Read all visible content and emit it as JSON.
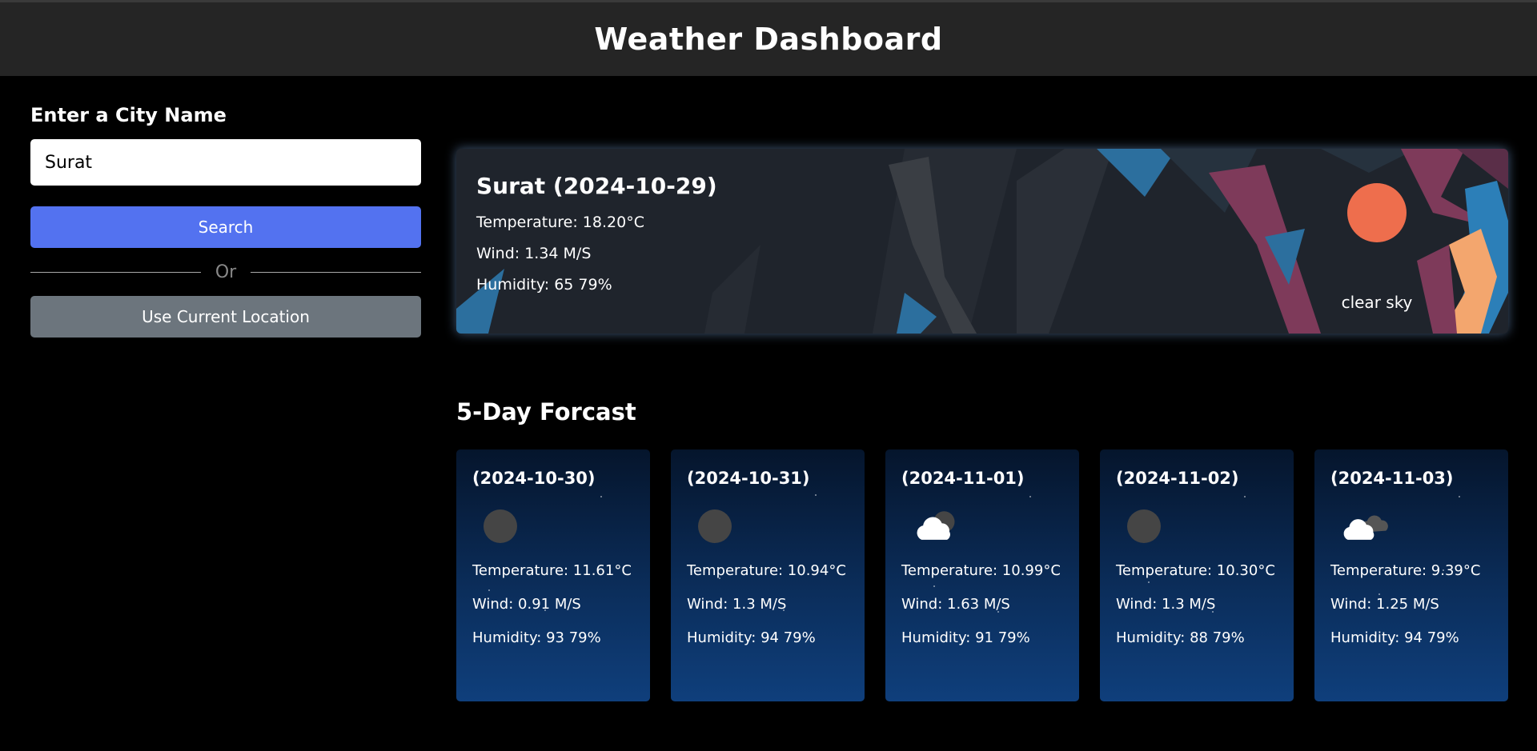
{
  "header": {
    "title": "Weather Dashboard"
  },
  "search": {
    "label": "Enter a City Name",
    "value": "Surat",
    "button": "Search",
    "divider": "Or",
    "location_button": "Use Current Location"
  },
  "current": {
    "title": "Surat (2024-10-29)",
    "temperature": "Temperature: 18.20°C",
    "wind": "Wind: 1.34 M/S",
    "humidity": "Humidity: 65 79%",
    "icon": "sun-icon",
    "description": "clear sky"
  },
  "forecast": {
    "title": "5-Day Forcast",
    "days": [
      {
        "date": "(2024-10-30)",
        "icon": "moon-icon",
        "temperature": "Temperature: 11.61°C",
        "wind": "Wind: 0.91 M/S",
        "humidity": "Humidity: 93 79%"
      },
      {
        "date": "(2024-10-31)",
        "icon": "moon-icon",
        "temperature": "Temperature: 10.94°C",
        "wind": "Wind: 1.3 M/S",
        "humidity": "Humidity: 94 79%"
      },
      {
        "date": "(2024-11-01)",
        "icon": "cloud-moon-icon",
        "temperature": "Temperature: 10.99°C",
        "wind": "Wind: 1.63 M/S",
        "humidity": "Humidity: 91 79%"
      },
      {
        "date": "(2024-11-02)",
        "icon": "moon-icon",
        "temperature": "Temperature: 10.30°C",
        "wind": "Wind: 1.3 M/S",
        "humidity": "Humidity: 88 79%"
      },
      {
        "date": "(2024-11-03)",
        "icon": "cloud-icon",
        "temperature": "Temperature: 9.39°C",
        "wind": "Wind: 1.25 M/S",
        "humidity": "Humidity: 94 79%"
      }
    ]
  },
  "colors": {
    "search_button": "#5372f0",
    "location_button": "#6c757d",
    "sun": "#ee6e4d",
    "header_bg": "#252525"
  }
}
